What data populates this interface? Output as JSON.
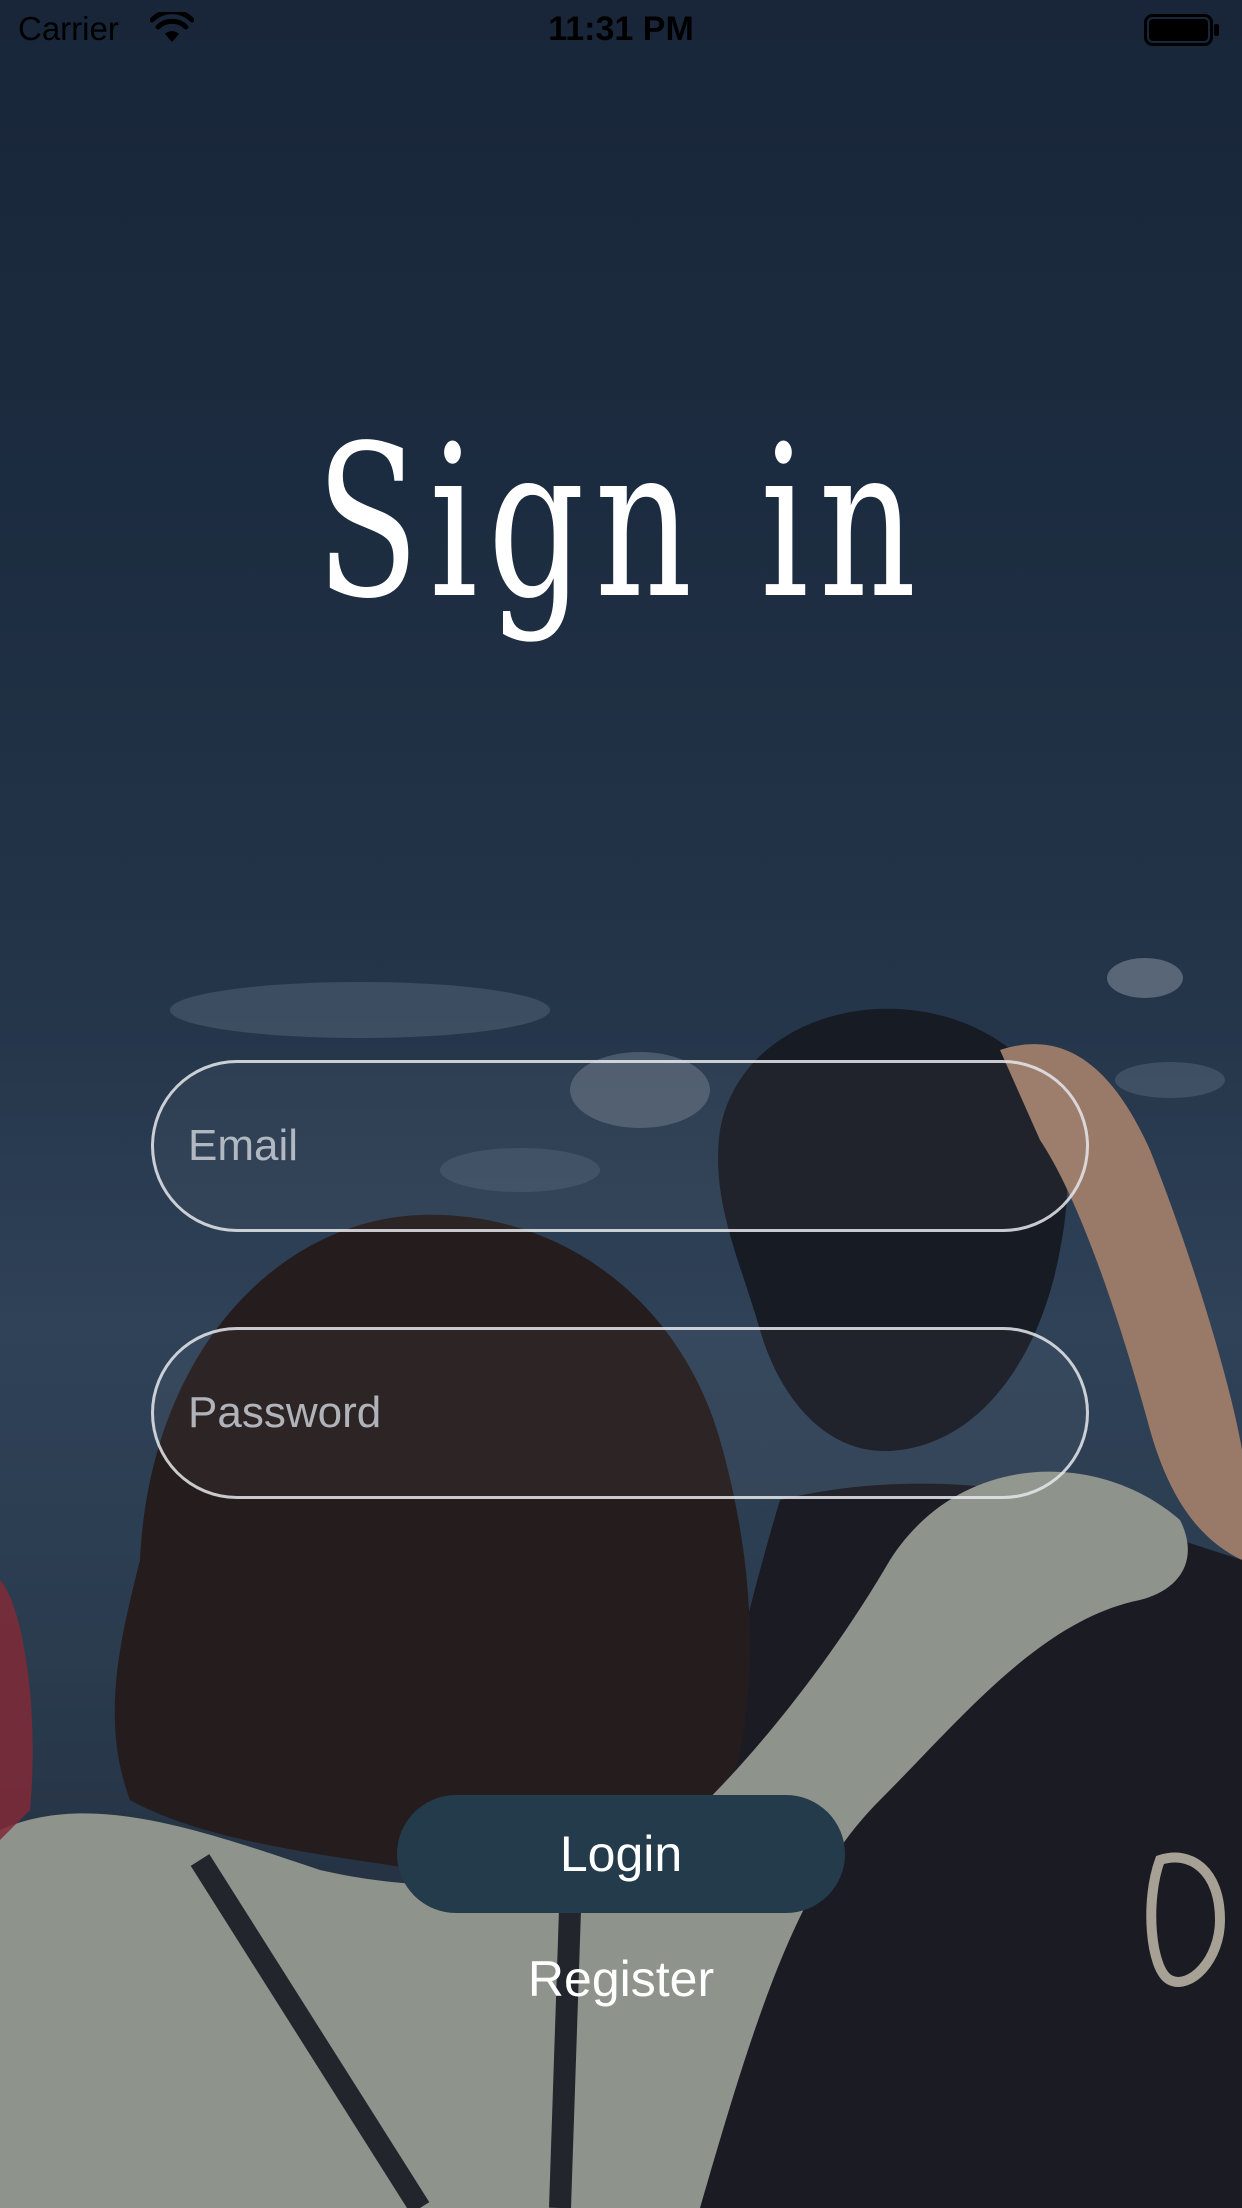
{
  "status_bar": {
    "carrier": "Carrier",
    "time": "11:31 PM",
    "wifi_icon": "wifi-icon",
    "battery_icon": "battery-icon"
  },
  "title": "Sign in",
  "email": {
    "placeholder": "Email",
    "value": ""
  },
  "password": {
    "placeholder": "Password",
    "value": ""
  },
  "login_button": {
    "label": "Login"
  },
  "register_link": {
    "label": "Register"
  },
  "colors": {
    "login_button_bg": "#243b4c",
    "field_border": "#e6e8ec",
    "text": "#ffffff"
  }
}
